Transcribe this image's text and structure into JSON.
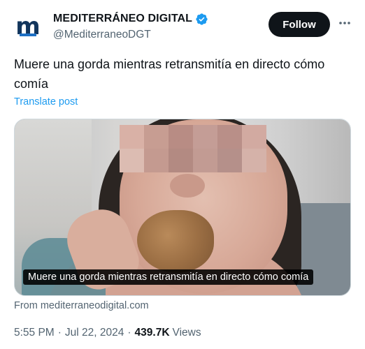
{
  "account": {
    "display_name": "MEDITERRÁNEO DIGITAL",
    "handle": "@MediterraneoDGT",
    "avatar_letter": "m",
    "verified_icon": "verified-badge-icon"
  },
  "actions": {
    "follow_label": "Follow",
    "more_icon": "more-horizontal-icon"
  },
  "post": {
    "text": "Muere una gorda mientras retransmitía en directo cómo comía",
    "translate_label": "Translate post"
  },
  "media": {
    "caption": "Muere una gorda mientras retransmitía en directo cómo comía",
    "source": "From mediterraneodigital.com"
  },
  "meta": {
    "time": "5:55 PM",
    "date": "Jul 22, 2024",
    "separator": "·",
    "views_count": "439.7K",
    "views_label": "Views"
  },
  "colors": {
    "accent": "#1d9bf0",
    "text_primary": "#0f1419",
    "text_secondary": "#536471",
    "follow_bg": "#0f1419",
    "avatar_brand": "#12355c"
  }
}
